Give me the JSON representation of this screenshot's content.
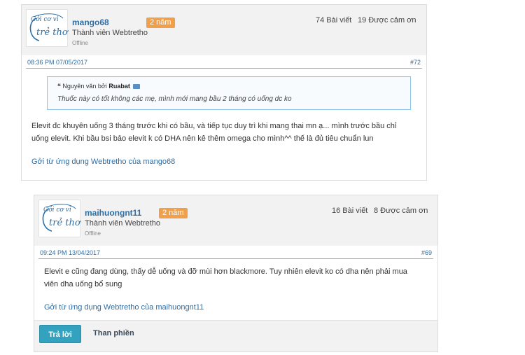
{
  "logo": {
    "line1": "Gởi cơ vì",
    "line2": "trẻ thơ"
  },
  "posts": [
    {
      "username": "mango68",
      "badge": "2 năm",
      "role": "Thành viên Webtretho",
      "status": "Offline",
      "posts_count": "74 Bài viết",
      "thanks": "19 Được cảm ơn",
      "datetime": "08:36 PM 07/05/2017",
      "number": "#72",
      "quote": {
        "prefix": "Nguyên văn bởi",
        "author": "Ruabat",
        "text": "Thuốc này có tốt không các mẹ, mình mới mang bầu 2 tháng có uống dc ko"
      },
      "body_line1": "Elevit đc khuyên uống 3 tháng trước khi có bầu, và tiếp tục duy trì khi mang thai mn ạ... mình trước bầu chỉ",
      "body_line2": "uống elevit. Khi bầu bsi bảo elevit k có DHA nên kê thêm omega cho mình^^ thế là đủ tiêu chuẩn lun",
      "from": "Gởi từ ứng dụng Webtretho của mango68"
    },
    {
      "username": "maihuongnt11",
      "badge": "2 năm",
      "role": "Thành viên Webtretho",
      "status": "Offline",
      "posts_count": "16 Bài viết",
      "thanks": "8 Được cảm ơn",
      "datetime": "09:24 PM 13/04/2017",
      "number": "#69",
      "body_line1": "Elevit e cũng đang dùng, thấy dễ uống và đỡ mùi hơn blackmore. Tuy nhiên elevit ko có dha nên phải mua",
      "body_line2": "viên dha uống bổ sung",
      "from": "Gởi từ ứng dụng Webtretho của maihuongnt11",
      "reply_label": "Trả lời",
      "report_label": "Than phiền"
    }
  ],
  "colors": {
    "link": "#2e6da4",
    "badge": "#f0a04b",
    "reply_button": "#33a2bf"
  }
}
